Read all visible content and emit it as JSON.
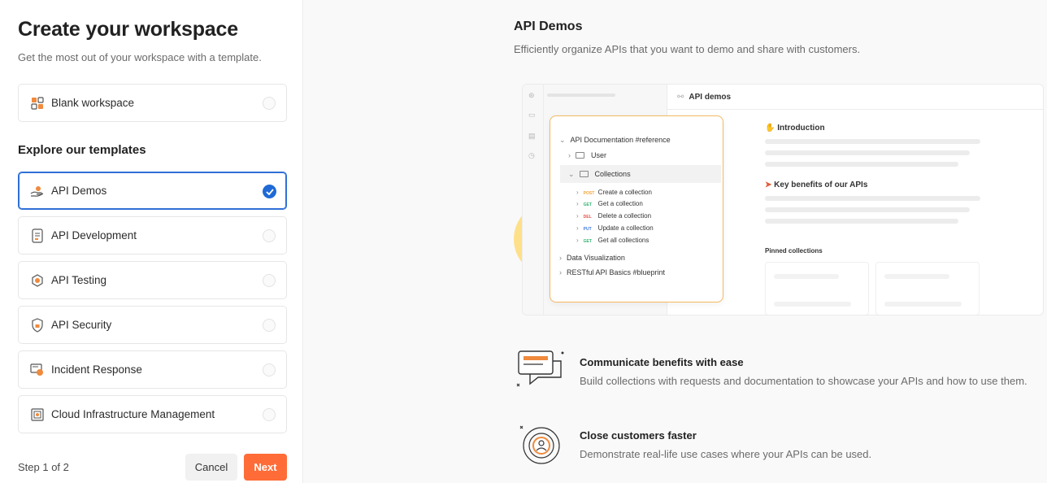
{
  "left": {
    "title": "Create your workspace",
    "subtitle": "Get the most out of your workspace with a template.",
    "blank": {
      "label": "Blank workspace",
      "icon": "grid-icon"
    },
    "section_title": "Explore our templates",
    "templates": [
      {
        "label": "API Demos",
        "icon": "hand-icon",
        "selected": true
      },
      {
        "label": "API Development",
        "icon": "document-icon",
        "selected": false
      },
      {
        "label": "API Testing",
        "icon": "hexagon-icon",
        "selected": false
      },
      {
        "label": "API Security",
        "icon": "lock-icon",
        "selected": false
      },
      {
        "label": "Incident Response",
        "icon": "alert-icon",
        "selected": false
      },
      {
        "label": "Cloud Infrastructure Management",
        "icon": "cloud-server-icon",
        "selected": false
      }
    ],
    "step": "Step 1 of 2",
    "cancel": "Cancel",
    "next": "Next"
  },
  "right": {
    "title": "API Demos",
    "subtitle": "Efficiently organize APIs that you want to demo and share with customers.",
    "preview": {
      "header": "API demos",
      "tree": {
        "root": "API Documentation #reference",
        "user": "User",
        "collections": "Collections",
        "requests": [
          {
            "method": "POST",
            "label": "Create a collection",
            "color": "#f2a33a"
          },
          {
            "method": "GET",
            "label": "Get a collection",
            "color": "#2eb56e"
          },
          {
            "method": "DEL",
            "label": "Delete a collection",
            "color": "#e5534b"
          },
          {
            "method": "PUT",
            "label": "Update a collection",
            "color": "#3f7be0"
          },
          {
            "method": "GET",
            "label": "Get all collections",
            "color": "#2eb56e"
          }
        ],
        "data_viz": "Data Visualization",
        "restful": "RESTful API Basics #blueprint"
      },
      "intro": "Introduction",
      "benefits": "Key benefits of our APIs",
      "pinned": "Pinned collections"
    },
    "features": [
      {
        "title": "Communicate benefits with ease",
        "desc": "Build collections with requests and documentation to showcase your APIs and how to use them.",
        "icon": "chat-icon"
      },
      {
        "title": "Close customers faster",
        "desc": "Demonstrate real-life use cases where your APIs can be used.",
        "icon": "target-person-icon"
      }
    ]
  },
  "colors": {
    "accent": "#ff6c37",
    "selected": "#1f6ad6",
    "tree_border": "#f4b962"
  }
}
